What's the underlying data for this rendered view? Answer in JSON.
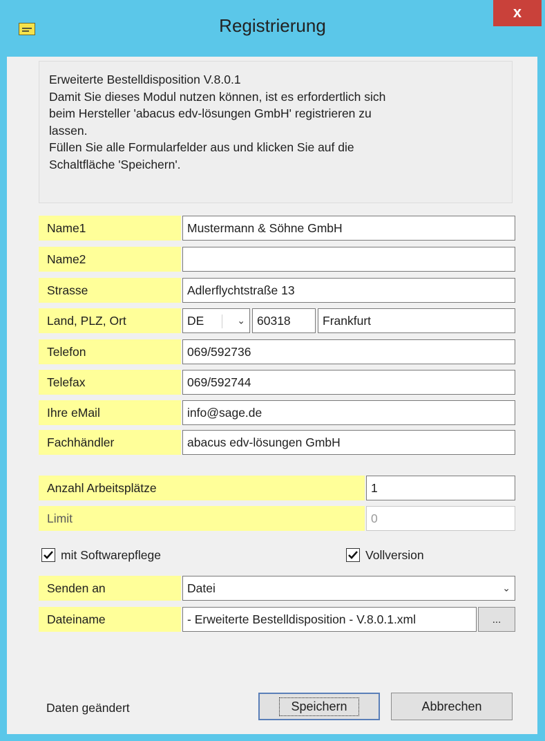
{
  "window": {
    "title": "Registrierung",
    "close_label": "x",
    "accent_color": "#5bc7e9",
    "close_color": "#c9413a"
  },
  "info": {
    "lines": [
      "Erweiterte Bestelldisposition V.8.0.1",
      "Damit Sie dieses Modul nutzen können, ist es erfordertlich sich",
      "beim Hersteller 'abacus edv-lösungen GmbH' registrieren zu",
      "lassen.",
      "Füllen Sie alle Formularfelder aus und klicken Sie auf die",
      "Schaltfläche 'Speichern'."
    ]
  },
  "form": {
    "name1": {
      "label": "Name1",
      "value": "Mustermann & Söhne GmbH"
    },
    "name2": {
      "label": "Name2",
      "value": ""
    },
    "strasse": {
      "label": "Strasse",
      "value": "Adlerflychtstraße 13"
    },
    "land_plz_ort": {
      "label": "Land, PLZ, Ort",
      "land": "DE",
      "plz": "60318",
      "ort": "Frankfurt"
    },
    "telefon": {
      "label": "Telefon",
      "value": "069/592736"
    },
    "telefax": {
      "label": "Telefax",
      "value": "069/592744"
    },
    "email": {
      "label": "Ihre eMail",
      "value": "info@sage.de"
    },
    "fachhaendler": {
      "label": "Fachhändler",
      "value": "abacus edv-lösungen GmbH"
    },
    "anzahl": {
      "label": "Anzahl Arbeitsplätze",
      "value": "1"
    },
    "limit": {
      "label": "Limit",
      "value": "0"
    },
    "softwarepflege": {
      "label": "mit Softwarepflege",
      "checked": true
    },
    "vollversion": {
      "label": "Vollversion",
      "checked": true
    },
    "senden_an": {
      "label": "Senden an",
      "value": "Datei"
    },
    "dateiname": {
      "label": "Dateiname",
      "value": "- Erweiterte Bestelldisposition - V.8.0.1.xml",
      "browse_label": "..."
    }
  },
  "footer": {
    "status": "Daten geändert",
    "save_label": "Speichern",
    "cancel_label": "Abbrechen"
  }
}
